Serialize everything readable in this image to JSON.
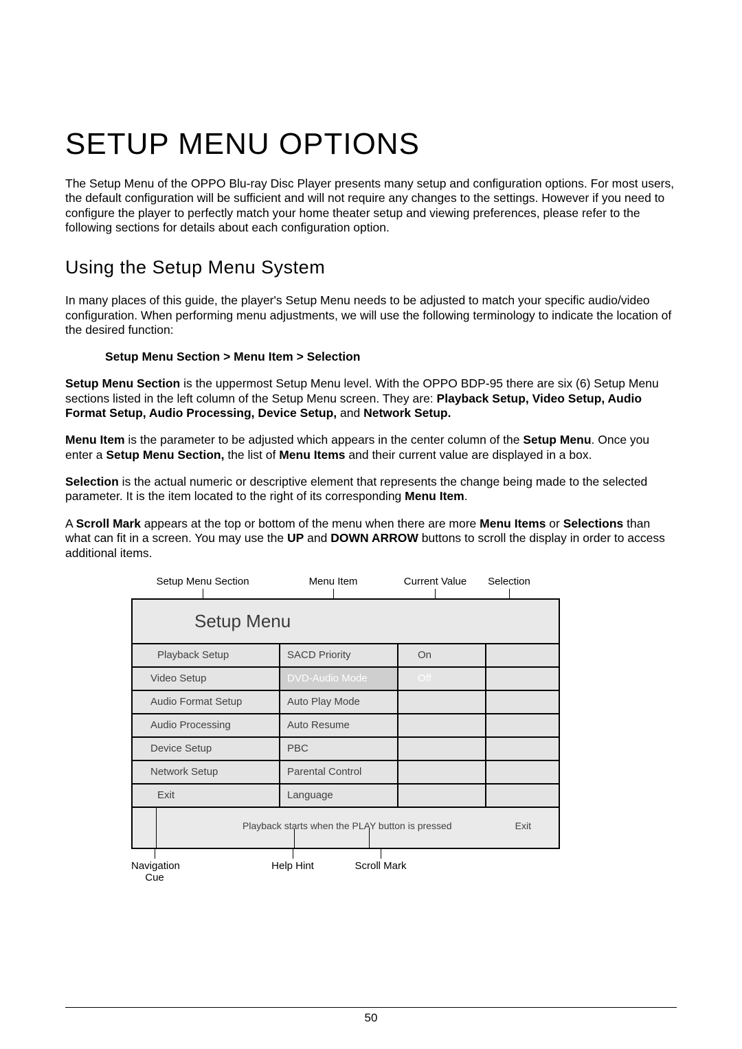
{
  "title": "SETUP MENU OPTIONS",
  "intro_p": "The Setup Menu of the OPPO Blu-ray Disc Player presents many setup and configuration options.  For most users, the default configuration will be sufficient and will not require any changes to the settings.  However if you need to configure the player to perfectly match your home theater setup and viewing preferences, please refer to the following sections for details about each configuration option.",
  "section_heading": "Using the Setup Menu System",
  "using_p": "In many places of this guide, the player's Setup Menu needs to be adjusted to match your specific audio/video configuration.  When performing menu adjustments, we will use the following terminology to indicate the location of the desired function:",
  "breadcrumb": "Setup Menu Section > Menu Item > Selection",
  "p_sms_bold": "Setup Menu Section",
  "p_sms_rest_1": " is the uppermost Setup Menu level. With the OPPO BDP-95 there are six (6) Setup Menu sections listed in the left column of the Setup Menu screen.  They are: ",
  "p_sms_bold_list": "Playback Setup, Video Setup, Audio Format Setup, Audio Processing, Device Setup,",
  "p_sms_rest_2": " and ",
  "p_sms_bold_end": "Network Setup.",
  "p_mi_b1": "Menu Item",
  "p_mi_t1": " is the parameter to be adjusted which appears in the center column of the ",
  "p_mi_b2": "Setup Menu",
  "p_mi_t2": ". Once you enter a ",
  "p_mi_b3": "Setup Menu Section,",
  "p_mi_t3": " the list of ",
  "p_mi_b4": "Menu Items",
  "p_mi_t4": " and their current value are displayed in a box.",
  "p_sel_b1": "Selection",
  "p_sel_t1": " is the actual numeric or descriptive element that represents the change being made to the selected parameter.  It is the item located to the right of its corresponding ",
  "p_sel_b2": "Menu Item",
  "p_sel_t2": ".",
  "p_scroll_t1": "A ",
  "p_scroll_b1": "Scroll Mark",
  "p_scroll_t2": " appears at the top or bottom of the menu when there are more ",
  "p_scroll_b2": "Menu Items",
  "p_scroll_t3": " or ",
  "p_scroll_b3": "Selections",
  "p_scroll_t4": " than what can fit in a screen.  You may use the ",
  "p_scroll_b4": "UP",
  "p_scroll_t5": " and ",
  "p_scroll_b5": "DOWN ARROW",
  "p_scroll_t6": " buttons to scroll the display in order to access additional items.",
  "annot_top": {
    "sm": "Setup Menu Section",
    "mi": "Menu Item",
    "cv": "Current Value",
    "sel": "Selection"
  },
  "diagram": {
    "title": "Setup Menu",
    "rows": [
      {
        "sec": "Playback Setup",
        "item": "SACD Priority",
        "val": "On"
      },
      {
        "sec": "Video Setup",
        "item": "DVD-Audio Mode",
        "val": "Off"
      },
      {
        "sec": "Audio Format Setup",
        "item": "Auto Play Mode",
        "val": ""
      },
      {
        "sec": "Audio Processing",
        "item": "Auto Resume",
        "val": ""
      },
      {
        "sec": "Device Setup",
        "item": "PBC",
        "val": ""
      },
      {
        "sec": "Network Setup",
        "item": "Parental Control",
        "val": ""
      },
      {
        "sec": "Exit",
        "item": "Language",
        "val": ""
      }
    ],
    "help_text": "Playback starts when the PLAY button is pressed",
    "exit_label": "Exit"
  },
  "annot_bot": {
    "nav": "Navigation Cue",
    "help": "Help Hint",
    "scroll": "Scroll Mark"
  },
  "page_number": "50"
}
